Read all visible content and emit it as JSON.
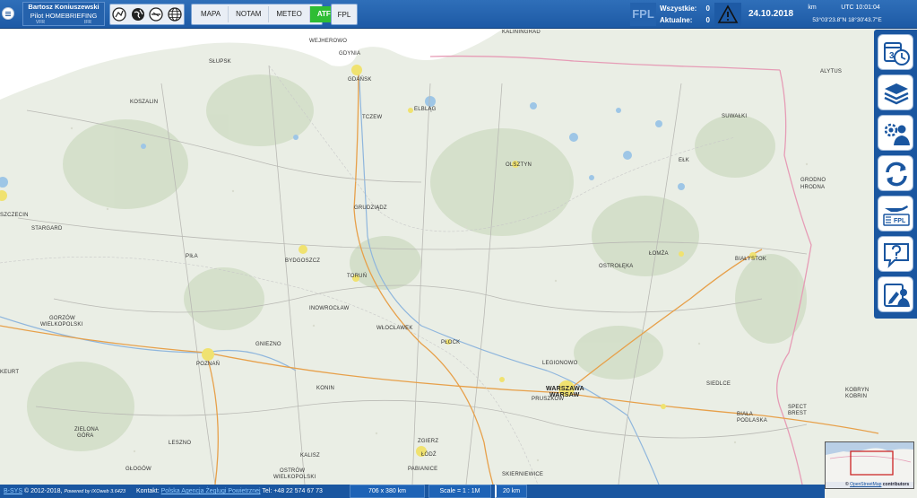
{
  "header": {
    "user_name": "Bartosz Koniuszewski",
    "user_role": "Pilot HOMEBRIEFING",
    "rule_left": "VFR",
    "rule_right": "IFR",
    "tabs": [
      {
        "label": "MAPA",
        "active": false
      },
      {
        "label": "NOTAM",
        "active": false
      },
      {
        "label": "METEO",
        "active": false
      },
      {
        "label": "ATFM",
        "active": true
      }
    ],
    "fpl_label": "FPL",
    "fpl_big": "FPL",
    "all_label": "Wszystkie:",
    "all_value": "0",
    "current_label": "Aktualne:",
    "current_value": "0",
    "date": "24.10.2018",
    "unit": "km",
    "utc": "UTC 10:01:04",
    "coords": "53°03'23.8\"N 18°30'43.7\"E",
    "active_color": "#2fbd34",
    "bar_color": "#1a56a0"
  },
  "map": {
    "cities": [
      {
        "label": "WEJHEROWO",
        "big": false
      },
      {
        "label": "GDYNIA",
        "big": false
      },
      {
        "label": "GDAŃSK",
        "big": false
      },
      {
        "label": "KALININGRAD",
        "big": false
      },
      {
        "label": "SŁUPSK",
        "big": false
      },
      {
        "label": "KOSZALIN",
        "big": false
      },
      {
        "label": "TCZEW",
        "big": false
      },
      {
        "label": "ELBLĄG",
        "big": false
      },
      {
        "label": "OLSZTYN",
        "big": false
      },
      {
        "label": "SUWAŁKI",
        "big": false
      },
      {
        "label": "ALYTUS",
        "big": false
      },
      {
        "label": "EŁK",
        "big": false
      },
      {
        "label": "GRODNO",
        "big": false
      },
      {
        "label": "HRODNA",
        "big": false
      },
      {
        "label": "SZCZECIN",
        "big": false
      },
      {
        "label": "STARGARD",
        "big": false
      },
      {
        "label": "GRUDZIĄDZ",
        "big": false
      },
      {
        "label": "PIŁA",
        "big": false
      },
      {
        "label": "BYDGOSZCZ",
        "big": false
      },
      {
        "label": "TORUŃ",
        "big": false
      },
      {
        "label": "OSTROŁĘKA",
        "big": false
      },
      {
        "label": "ŁOMŻA",
        "big": false
      },
      {
        "label": "BIAŁYSTOK",
        "big": false
      },
      {
        "label": "GORZÓW",
        "big": false
      },
      {
        "label": "WIELKOPOLSKI",
        "big": false
      },
      {
        "label": "INOWROCŁAW",
        "big": false
      },
      {
        "label": "WŁOCŁAWEK",
        "big": false
      },
      {
        "label": "PŁOCK",
        "big": false
      },
      {
        "label": "GNIEZNO",
        "big": false
      },
      {
        "label": "POZNAŃ",
        "big": false
      },
      {
        "label": "LEGIONOWO",
        "big": false
      },
      {
        "label": "WARSZAWA",
        "big": true
      },
      {
        "label": "WARSAW",
        "big": true
      },
      {
        "label": "PRUSZKÓW",
        "big": false
      },
      {
        "label": "KONIN",
        "big": false
      },
      {
        "label": "SIEDLCE",
        "big": false
      },
      {
        "label": "KOBRYN",
        "big": false
      },
      {
        "label": "KOBRIN",
        "big": false
      },
      {
        "label": "SPECT",
        "big": false
      },
      {
        "label": "BREST",
        "big": false
      },
      {
        "label": "BIAŁA",
        "big": false
      },
      {
        "label": "PODLASKA",
        "big": false
      },
      {
        "label": "ZIELONA",
        "big": false
      },
      {
        "label": "GÓRA",
        "big": false
      },
      {
        "label": "LESZNO",
        "big": false
      },
      {
        "label": "KALISZ",
        "big": false
      },
      {
        "label": "ZGIERZ",
        "big": false
      },
      {
        "label": "ŁÓDŹ",
        "big": false
      },
      {
        "label": "PABIANICE",
        "big": false
      },
      {
        "label": "GŁOGÓW",
        "big": false
      },
      {
        "label": "OSTRÓW",
        "big": false
      },
      {
        "label": "WIELKOPOLSKI",
        "big": false
      },
      {
        "label": "SKIERNIEWICE",
        "big": false
      },
      {
        "label": "KEURT",
        "big": false
      }
    ]
  },
  "right_toolbar": {
    "buttons": [
      {
        "icon": "calendar-clock-icon"
      },
      {
        "icon": "layers-icon"
      },
      {
        "icon": "users-gear-icon"
      },
      {
        "icon": "refresh-icon"
      },
      {
        "icon": "airplane-fpl-icon"
      },
      {
        "icon": "help-icon"
      },
      {
        "icon": "user-edit-icon"
      }
    ],
    "fpl_mini": "FPL"
  },
  "overview": {
    "credit_prefix": "©",
    "credit_link": "OpenStreetMap",
    "credit_suffix": "contributors"
  },
  "status": {
    "brand": "B-SYS",
    "copyright": "© 2012-2018,",
    "powered": "Powered by IXOweb 3.6423",
    "contact_label": "Kontakt:",
    "contact_link": "Polska Agencja Żeglugi Powietrznej",
    "phone": "Tel: +48 22 574 67 73",
    "dims": "706 x 380 km",
    "scale": "Scale = 1 : 1M",
    "scale_bar": "20 km"
  }
}
